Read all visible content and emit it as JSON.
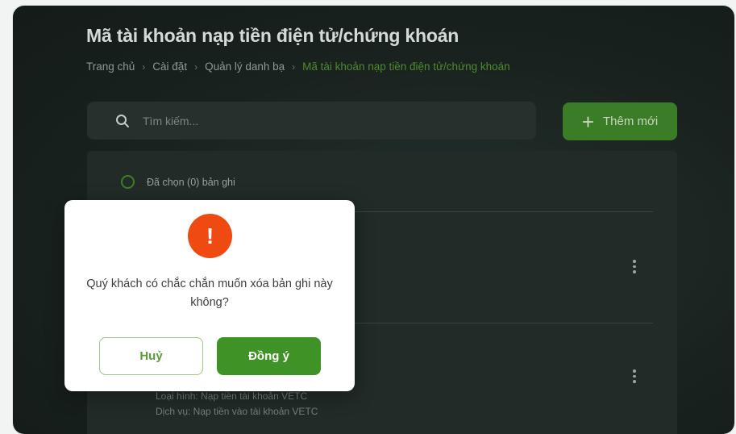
{
  "page": {
    "title": "Mã tài khoản nạp tiền điện tử/chứng khoán"
  },
  "breadcrumb": {
    "items": [
      "Trang chủ",
      "Cài đặt",
      "Quản lý danh bạ"
    ],
    "current": "Mã tài khoản nạp tiền điện tử/chứng khoán",
    "separator": "›"
  },
  "search": {
    "placeholder": "Tìm kiếm...",
    "icon": "search-icon"
  },
  "toolbar": {
    "add_label": "Thêm mới",
    "add_icon": "plus-icon"
  },
  "list": {
    "selected_label": "Đã chọn (0) bản ghi",
    "last_item": {
      "type_line": "Loại hình: Nạp tiền tài khoản VETC",
      "service_line": "Dịch vụ: Nạp tiền vào tài khoản VETC"
    }
  },
  "modal": {
    "icon": "alert-icon",
    "icon_glyph": "!",
    "message": "Quý khách có chắc chắn muốn xóa bản ghi này không?",
    "cancel_label": "Huỷ",
    "confirm_label": "Đồng ý"
  },
  "colors": {
    "accent": "#3f9225",
    "alert": "#f04a13",
    "breadcrumb_current": "#4f8a2e"
  }
}
